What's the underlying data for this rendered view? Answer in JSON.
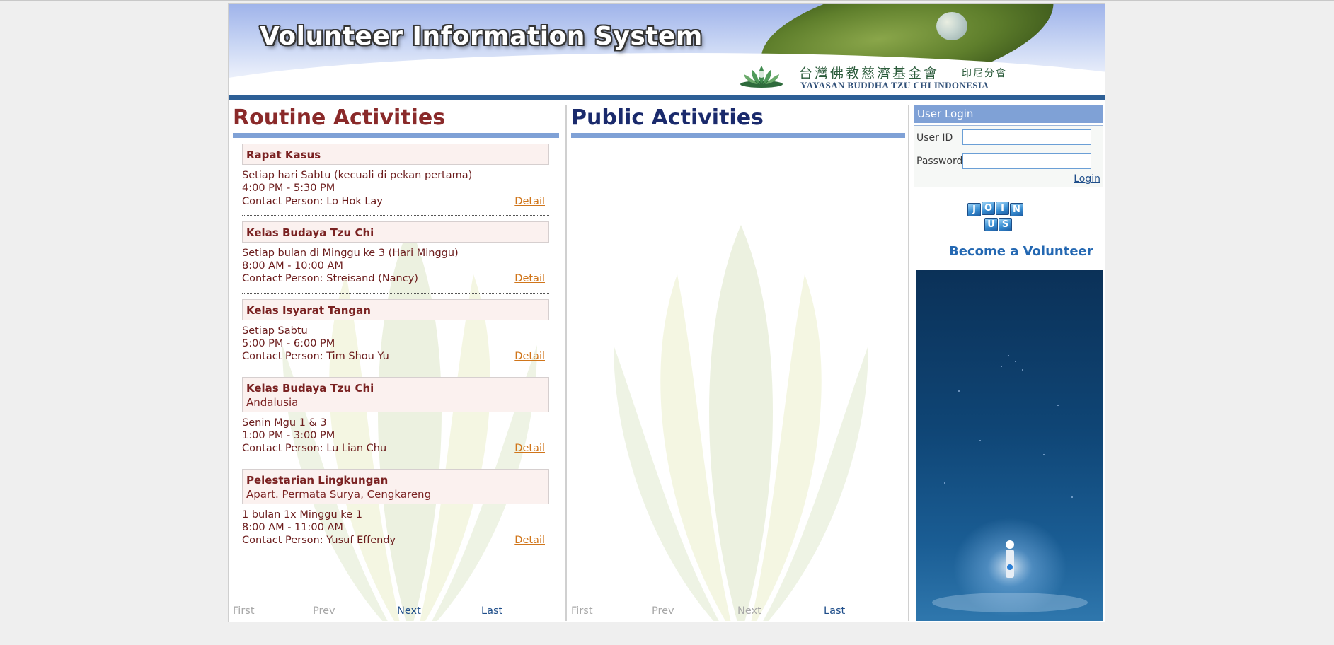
{
  "header": {
    "title": "Volunteer Information System",
    "chinese_name": "台灣佛教慈濟基金會",
    "chinese_sub": "印尼分會",
    "org_name": "YAYASAN BUDDHA TZU CHI INDONESIA"
  },
  "routine": {
    "title": "Routine Activities",
    "items": [
      {
        "name": "Rapat Kasus",
        "location": "",
        "schedule": "Setiap hari Sabtu (kecuali di pekan pertama)",
        "time": "4:00 PM - 5:30 PM",
        "contact": "Contact Person: Lo Hok Lay",
        "detail": "Detail"
      },
      {
        "name": "Kelas Budaya Tzu Chi",
        "location": "",
        "schedule": "Setiap bulan di Minggu ke 3 (Hari Minggu)",
        "time": "8:00 AM - 10:00 AM",
        "contact": "Contact Person: Streisand (Nancy)",
        "detail": "Detail"
      },
      {
        "name": "Kelas Isyarat Tangan",
        "location": "",
        "schedule": "Setiap Sabtu",
        "time": "5:00 PM - 6:00 PM",
        "contact": "Contact Person: Tim Shou Yu",
        "detail": "Detail"
      },
      {
        "name": "Kelas Budaya Tzu Chi",
        "location": "Andalusia",
        "schedule": "Senin Mgu 1 & 3",
        "time": "1:00 PM - 3:00 PM",
        "contact": "Contact Person: Lu Lian Chu",
        "detail": "Detail"
      },
      {
        "name": "Pelestarian Lingkungan",
        "location": "Apart. Permata Surya, Cengkareng",
        "schedule": "1 bulan 1x Minggu ke 1",
        "time": "8:00 AM - 11:00 AM",
        "contact": "Contact Person: Yusuf Effendy",
        "detail": "Detail"
      }
    ],
    "pager": {
      "first": "First",
      "prev": "Prev",
      "next": "Next",
      "last": "Last"
    }
  },
  "public": {
    "title": "Public Activities",
    "pager": {
      "first": "First",
      "prev": "Prev",
      "next": "Next",
      "last": "Last"
    }
  },
  "login": {
    "title": "User Login",
    "user_label": "User ID",
    "user_value": "",
    "password_label": "Password",
    "password_value": "",
    "login_link": "Login"
  },
  "join": {
    "cubes": [
      "J",
      "O",
      "I",
      "N",
      "U",
      "S"
    ],
    "tagline": "Become a Volunteer"
  },
  "colors": {
    "routine_title": "#8a2a2a",
    "public_title": "#1a2a6c",
    "detail_link": "#d0751a",
    "header_bar": "#2d5f96",
    "section_rule": "#7fa1d6"
  }
}
